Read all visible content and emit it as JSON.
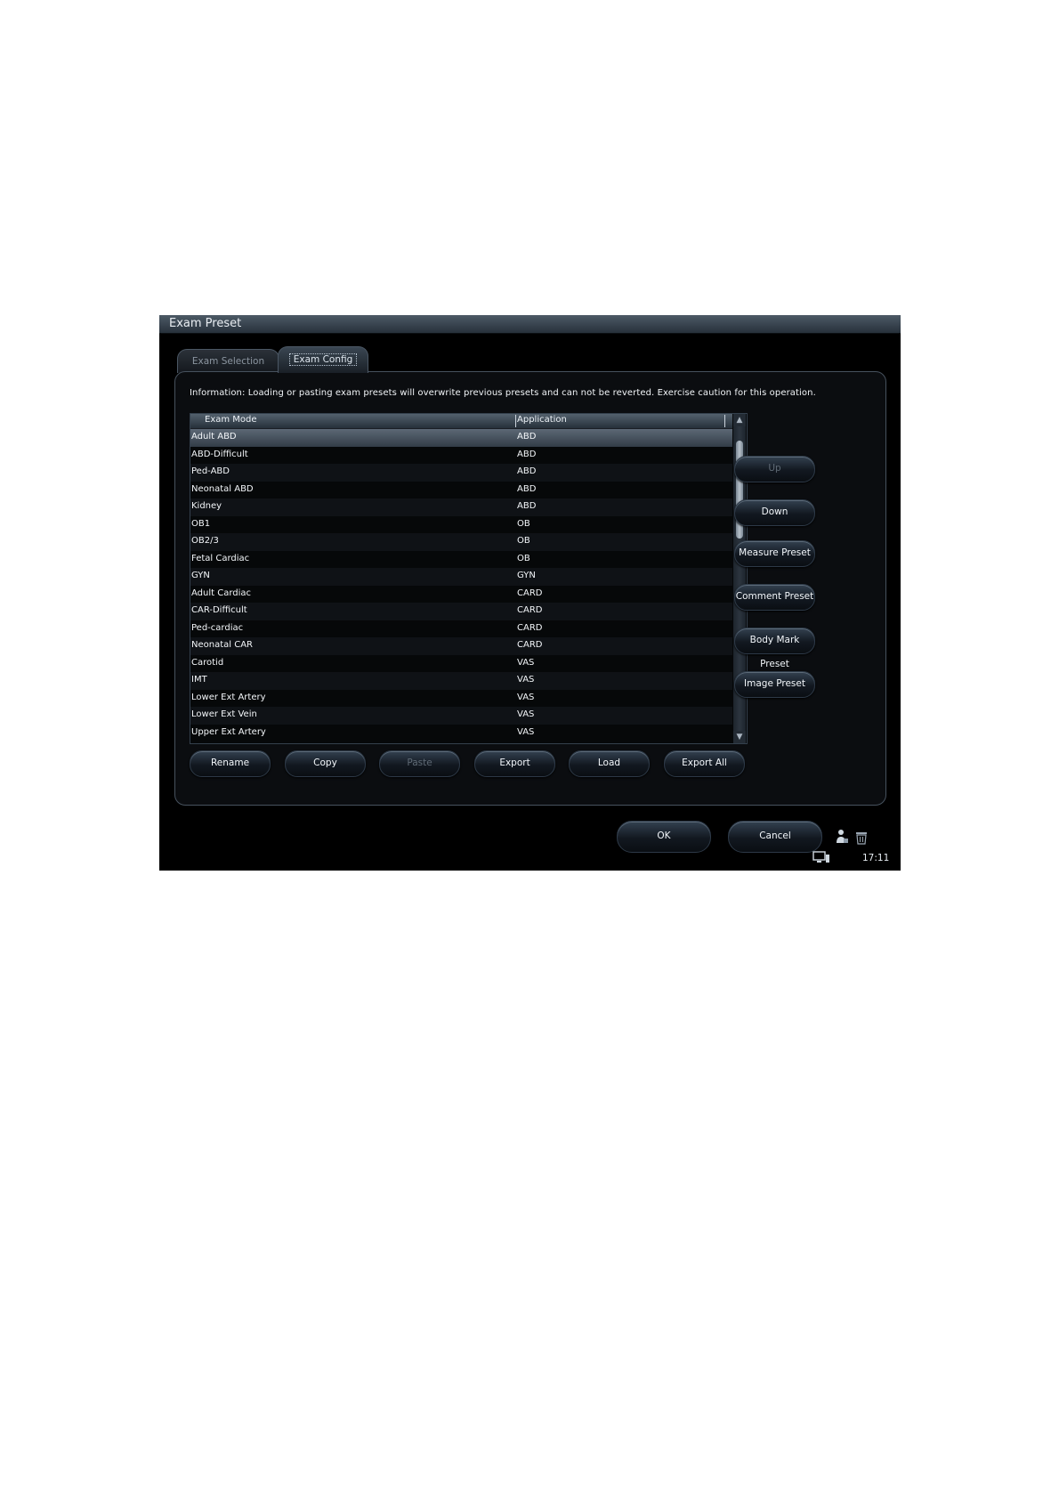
{
  "window": {
    "title": "Exam Preset"
  },
  "tabs": [
    {
      "label": "Exam Selection",
      "active": false
    },
    {
      "label": "Exam Config",
      "active": true
    }
  ],
  "info_text": "Information: Loading or pasting exam presets will overwrite previous presets and can not be reverted. Exercise caution for this operation.",
  "table": {
    "columns": [
      "Exam Mode",
      "Application"
    ],
    "rows": [
      {
        "mode": "Adult ABD",
        "app": "ABD",
        "selected": true
      },
      {
        "mode": "ABD-Difficult",
        "app": "ABD"
      },
      {
        "mode": "Ped-ABD",
        "app": "ABD"
      },
      {
        "mode": "Neonatal ABD",
        "app": "ABD"
      },
      {
        "mode": "Kidney",
        "app": "ABD"
      },
      {
        "mode": "OB1",
        "app": "OB"
      },
      {
        "mode": "OB2/3",
        "app": "OB"
      },
      {
        "mode": "Fetal Cardiac",
        "app": "OB"
      },
      {
        "mode": "GYN",
        "app": "GYN"
      },
      {
        "mode": "Adult Cardiac",
        "app": "CARD"
      },
      {
        "mode": "CAR-Difficult",
        "app": "CARD"
      },
      {
        "mode": "Ped-cardiac",
        "app": "CARD"
      },
      {
        "mode": "Neonatal CAR",
        "app": "CARD"
      },
      {
        "mode": "Carotid",
        "app": "VAS"
      },
      {
        "mode": "IMT",
        "app": "VAS"
      },
      {
        "mode": "Lower Ext Artery",
        "app": "VAS"
      },
      {
        "mode": "Lower Ext Vein",
        "app": "VAS"
      },
      {
        "mode": "Upper Ext Artery",
        "app": "VAS"
      }
    ]
  },
  "side_buttons": {
    "up": "Up",
    "down": "Down",
    "measure_preset": "Measure Preset",
    "comment_preset": "Comment Preset",
    "body_mark_preset": "Body Mark Preset",
    "image_preset": "Image Preset"
  },
  "bottom_buttons": {
    "rename": "Rename",
    "copy": "Copy",
    "paste": "Paste",
    "export": "Export",
    "load": "Load",
    "export_all": "Export All"
  },
  "dialog_buttons": {
    "ok": "OK",
    "cancel": "Cancel"
  },
  "status": {
    "time": "17:11"
  },
  "icons": {
    "user": "user-icon",
    "trash": "trash-icon",
    "monitor": "monitor-icon",
    "scroll_up": "scroll-up-arrow-icon",
    "scroll_down": "scroll-down-arrow-icon"
  },
  "colors": {
    "background": "#000000",
    "selected_row": "#5c6875",
    "button_top": "#334150",
    "text": "#f2f6fa"
  }
}
